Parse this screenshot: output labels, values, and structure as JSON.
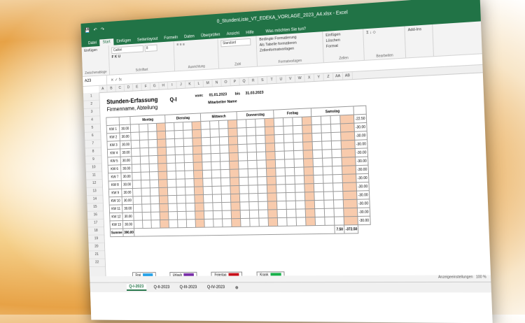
{
  "window": {
    "title": "0_StundenListe_VT_EDEKA_VORLAGE_2023_A4.xlsx - Excel"
  },
  "ribbon_tabs": [
    "Datei",
    "Start",
    "Einfügen",
    "Seitenlayout",
    "Formeln",
    "Daten",
    "Überprüfen",
    "Ansicht",
    "Hilfe"
  ],
  "tell_me": "Was möchten Sie tun?",
  "ribbon": {
    "paste": "Einfügen",
    "clipboard": "Zwischenablage",
    "font": "Calibri",
    "font_size": "8",
    "font_group": "Schriftart",
    "align_group": "Ausrichtung",
    "number_format": "Standard",
    "number_group": "Zahl",
    "cond_format": "Bedingte Formatierung",
    "as_table": "Als Tabelle formatieren",
    "cell_styles": "Zellenformatvorlagen",
    "styles_group": "Formatvorlagen",
    "insert": "Einfügen",
    "delete": "Löschen",
    "format": "Format",
    "cells_group": "Zellen",
    "edit_group": "Bearbeiten",
    "addins": "Add-Ins"
  },
  "name_box": "A23",
  "columns": [
    "A",
    "B",
    "C",
    "D",
    "E",
    "F",
    "G",
    "H",
    "I",
    "J",
    "K",
    "L",
    "M",
    "N",
    "O",
    "P",
    "Q",
    "R",
    "S",
    "T",
    "U",
    "V",
    "W",
    "X",
    "Y",
    "Z",
    "AA",
    "AB"
  ],
  "rows": [
    "1",
    "2",
    "3",
    "4",
    "5",
    "6",
    "7",
    "8",
    "9",
    "10",
    "11",
    "12",
    "13",
    "14",
    "15",
    "16",
    "17",
    "18",
    "19",
    "20",
    "21",
    "22"
  ],
  "sheet": {
    "title": "Stunden-Erfassung",
    "subtitle": "Firmenname, Abteilung",
    "quarter": "Q-I",
    "vom_label": "vom:",
    "vom": "01.01.2023",
    "bis_label": "bis",
    "bis": "31.03.2023",
    "employee": "Mitarbeiter Name",
    "days": [
      "Montag",
      "Dienstag",
      "Mittwoch",
      "Donnerstag",
      "Freitag",
      "Samstag"
    ],
    "weeks": [
      "KW 1",
      "KW 2",
      "KW 3",
      "KW 4",
      "KW 5",
      "KW 6",
      "KW 7",
      "KW 8",
      "KW 9",
      "KW 10",
      "KW 11",
      "KW 12",
      "KW 13"
    ],
    "hours": [
      "30.00",
      "30.00",
      "30.00",
      "30.00",
      "30.00",
      "30.00",
      "30.00",
      "30.00",
      "30.00",
      "30.00",
      "30.00",
      "30.00",
      "30.00"
    ],
    "summe_label": "Summe",
    "summe": "390.00",
    "balance": [
      "-22.50",
      "-30.00",
      "-30.00",
      "-30.00",
      "-30.00",
      "-30.00",
      "-30.00",
      "-30.00",
      "-30.00",
      "-30.00",
      "-30.00",
      "-30.00",
      "-30.00"
    ],
    "totals": [
      "7.50",
      "-372.50"
    ]
  },
  "legend": [
    {
      "label": "Frei",
      "color": "#29a3e8"
    },
    {
      "label": "Urlaub",
      "color": "#7a2fa8"
    },
    {
      "label": "Feiertag",
      "color": "#c8101a"
    },
    {
      "label": "Krank",
      "color": "#17b04a"
    }
  ],
  "sheet_tabs": [
    "Q-I-2023",
    "Q-II-2023",
    "Q-III-2023",
    "Q-IV-2023"
  ],
  "status": {
    "zoom": "100 %",
    "display": "Anzeigeeinstellungen"
  }
}
